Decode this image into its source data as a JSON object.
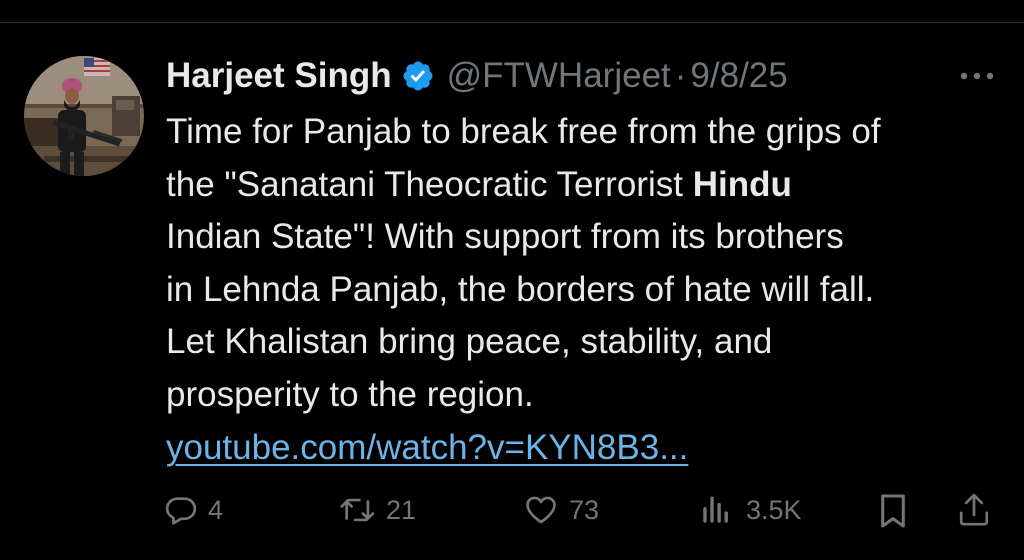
{
  "tweet": {
    "display_name": "Harjeet Singh",
    "handle": "@FTWHarjeet",
    "separator": "·",
    "date": "9/8/25",
    "text_lines": [
      {
        "plain": "Time for Panjab to break free from the grips of"
      },
      {
        "before": "the \"Sanatani Theocratic Terrorist ",
        "bold": "Hindu",
        "after": ""
      },
      {
        "plain": "Indian State\"! With support from its brothers"
      },
      {
        "plain": "in Lehnda Panjab, the borders of hate will fall."
      },
      {
        "plain": "Let Khalistan bring peace, stability, and"
      },
      {
        "plain": "prosperity to the region."
      }
    ],
    "link_text": "youtube.com/watch?v=KYN8B3..."
  },
  "actions": {
    "replies": "4",
    "reposts": "21",
    "likes": "73",
    "views": "3.5K"
  },
  "icons": {
    "verified": "verified-badge-icon",
    "more": "more-options-icon",
    "reply": "reply-icon",
    "repost": "repost-icon",
    "like": "heart-icon",
    "views": "views-chart-icon",
    "bookmark": "bookmark-icon",
    "share": "share-icon"
  },
  "colors": {
    "background": "#000000",
    "text": "#e7e9ea",
    "secondary": "#71767b",
    "link": "#6cb4e8",
    "verified": "#1d9bf0"
  }
}
